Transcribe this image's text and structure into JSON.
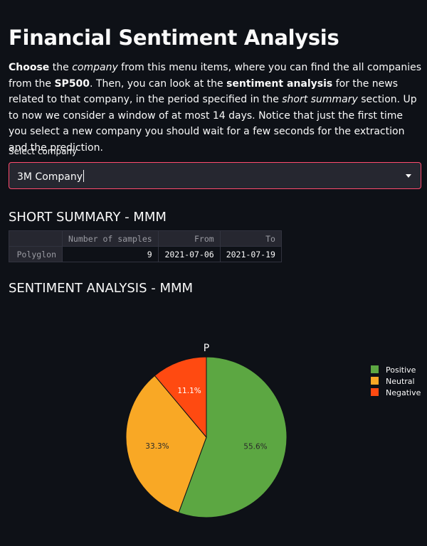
{
  "title": "Financial Sentiment Analysis",
  "intro": {
    "p1_bold": "Choose",
    "p2": " the ",
    "p3_italic": "company",
    "p4": " from this menu items, where you can find the all companies from the ",
    "p5_bold": "SP500",
    "p6": ". Then, you can look at the ",
    "p7_bold": "sentiment analysis",
    "p8": " for the news related to that company, in the period specified in the ",
    "p9_italic": "short summary",
    "p10": " section. Up to now we consider a window of at most 14 days. Notice that just the first time you select a new company you should wait for a few seconds for the extraction and the prediction."
  },
  "select": {
    "label": "Select company",
    "value": "3M Company"
  },
  "summary": {
    "heading": "SHORT SUMMARY - MMM",
    "columns": [
      "",
      "Number of samples",
      "From",
      "To"
    ],
    "rows": [
      {
        "index": "Polyglon",
        "samples": "9",
        "from": "2021-07-06",
        "to": "2021-07-19"
      }
    ]
  },
  "sentiment": {
    "heading": "SENTIMENT ANALYSIS - MMM"
  },
  "chart_data": {
    "type": "pie",
    "title": "P",
    "categories": [
      "Positive",
      "Neutral",
      "Negative"
    ],
    "values": [
      55.6,
      33.3,
      11.1
    ],
    "labels": [
      "55.6%",
      "33.3%",
      "11.1%"
    ],
    "colors": [
      "#5ca742",
      "#f9a825",
      "#ff4a11"
    ],
    "legend": "top-right"
  }
}
